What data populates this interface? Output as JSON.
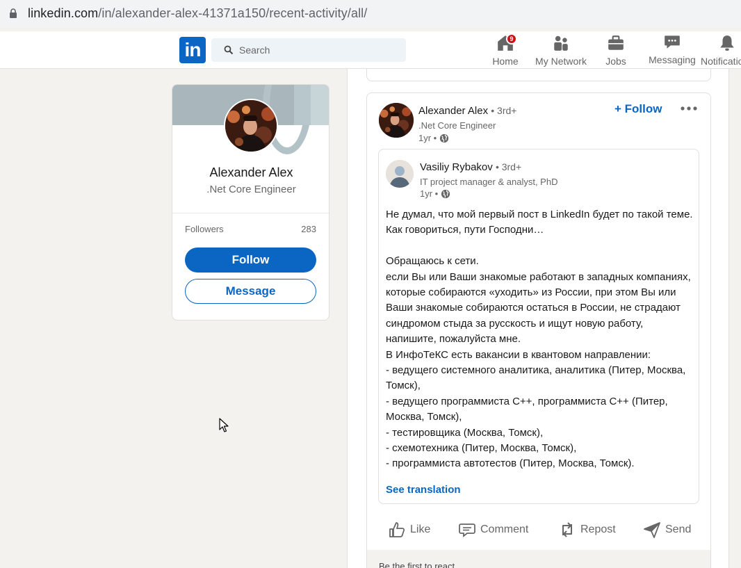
{
  "browser": {
    "url_host": "linkedin.com",
    "url_path": "/in/alexander-alex-41371a150/recent-activity/all/",
    "lock_icon": "lock-icon"
  },
  "nav": {
    "logo": "in",
    "search_placeholder": "Search",
    "items": [
      {
        "label": "Home",
        "icon": "home-icon",
        "badge": "9"
      },
      {
        "label": "My Network",
        "icon": "network-icon"
      },
      {
        "label": "Jobs",
        "icon": "briefcase-icon"
      },
      {
        "label": "Messaging",
        "icon": "messaging-icon"
      },
      {
        "label": "Notifications",
        "icon": "bell-icon"
      }
    ],
    "accent": "#0a66c2"
  },
  "profile": {
    "name": "Alexander Alex",
    "headline": ".Net Core Engineer",
    "followers_label": "Followers",
    "followers_count": "283",
    "follow_label": "Follow",
    "message_label": "Message"
  },
  "post": {
    "author": "Alexander Alex",
    "degree": "• 3rd+",
    "headline": ".Net Core Engineer",
    "time": "1yr •",
    "follow_label": "+ Follow",
    "shared": {
      "author": "Vasiliy Rybakov",
      "degree": "• 3rd+",
      "headline": "IT project manager & analyst, PhD",
      "time": "1yr •",
      "text_p1": "Не думал, что мой первый пост в LinkedIn будет по такой теме. Как говориться, пути Господни…",
      "text_p2_a": "Обращаюсь к сети.",
      "text_p2_b": "если Вы или Ваши знакомые работают в западных компаниях, которые собираются «уходить» из России, при этом Вы или Ваши знакомые собираются остаться в России,",
      "text_p2_underlined": "не страдают синдромом стыда за русскость",
      "text_p2_c": "и ищут новую работу, напишите, пожалуйста мне.",
      "text_p3": "В ИнфоТеКС есть вакансии в квантовом направлении:",
      "vacancies": [
        "- ведущего системного аналитика, аналитика (Питер, Москва, Томск),",
        "- ведущего программиста С++, программиста С++ (Питер, Москва, Томск),",
        "- тестировщика (Москва, Томск),",
        "- схемотехника (Питер, Москва, Томск),",
        "- программиста автотестов (Питер, Москва, Томск)."
      ],
      "see_translation": "See translation"
    },
    "actions": [
      "Like",
      "Comment",
      "Repost",
      "Send"
    ],
    "react_text": "Be the first to react"
  }
}
